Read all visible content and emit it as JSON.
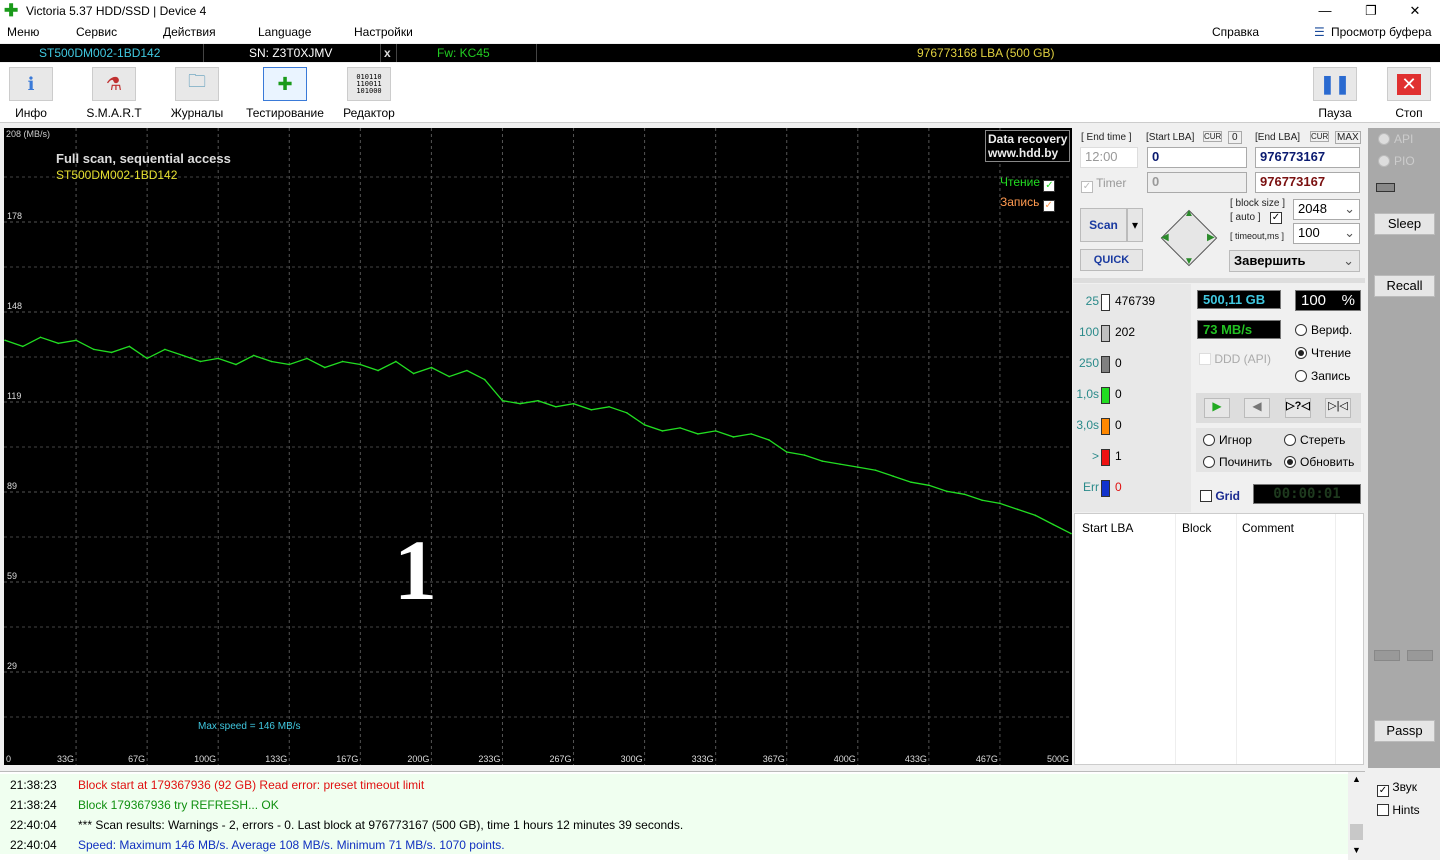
{
  "window": {
    "title": "Victoria 5.37 HDD/SSD | Device 4",
    "minimize": "—",
    "restore": "❐",
    "close": "✕"
  },
  "menu": {
    "items": [
      "Меню",
      "Сервис",
      "Действия",
      "Language",
      "Настройки"
    ],
    "help": "Справка",
    "buffer": "Просмотр буфера"
  },
  "device": {
    "model": "ST500DM002-1BD142",
    "serial": "SN: Z3T0XJMV",
    "x": "x",
    "firmware": "Fw: KC45",
    "capacity": "976773168 LBA (500 GB)"
  },
  "toolbar": {
    "items": [
      "Инфо",
      "S.M.A.R.T",
      "Журналы",
      "Тестирование",
      "Редактор"
    ],
    "pause": "Пауза",
    "stop": "Стоп"
  },
  "chart_data": {
    "type": "line",
    "title": "Full scan, sequential access",
    "subtitle": "ST500DM002-1BD142",
    "ylabel": "208 (MB/s)",
    "ylim": [
      0,
      208
    ],
    "xlim": [
      0,
      500
    ],
    "yticks": [
      178,
      148,
      119,
      89,
      59,
      29,
      0
    ],
    "xticks": [
      "0",
      "33G",
      "67G",
      "100G",
      "133G",
      "167G",
      "200G",
      "233G",
      "267G",
      "300G",
      "333G",
      "367G",
      "400G",
      "433G",
      "467G",
      "500G"
    ],
    "annotation": "Max speed = 146 MB/s",
    "grid": true,
    "legend": {
      "read": "Чтение",
      "write": "Запись",
      "placement": "top-right"
    },
    "big_label": "1",
    "watermark": [
      "Data recovery",
      "www.hdd.by"
    ],
    "series": [
      {
        "name": "Чтение",
        "color": "#22dd22",
        "values": [
          139,
          137,
          140,
          138,
          139,
          136,
          135,
          137,
          133,
          136,
          134,
          132,
          133,
          131,
          134,
          132,
          131,
          133,
          130,
          132,
          131,
          129,
          132,
          128,
          130,
          127,
          129,
          126,
          119,
          118,
          119,
          117,
          118,
          116,
          117,
          115,
          111,
          109,
          110,
          108,
          109,
          107,
          108,
          106,
          102,
          101,
          99,
          98,
          97,
          96,
          94,
          92,
          91,
          89,
          88,
          86,
          85,
          83,
          81,
          78,
          75
        ]
      }
    ]
  },
  "panel": {
    "end_time_label": "[ End time ]",
    "end_time": "12:00",
    "start_lba_label": "[Start LBA]",
    "cur": "CUR",
    "zero": "0",
    "end_lba_label": "[End LBA]",
    "max": "MAX",
    "start_lba": "0",
    "end_lba": "976773167",
    "timer_label": "Timer",
    "timer_value": "0",
    "end_lba2": "976773167",
    "scan": "Scan",
    "quick": "QUICK",
    "block_size_label": "[ block size ]",
    "auto_label": "[ auto ]",
    "timeout_label": "[ timeout,ms ]",
    "block_size": "2048",
    "timeout": "100",
    "finish": "Завершить",
    "legend": [
      {
        "n": "25",
        "v": "476739",
        "c": "#ffffff"
      },
      {
        "n": "100",
        "v": "202",
        "c": "#c0c0c0"
      },
      {
        "n": "250",
        "v": "0",
        "c": "#808080"
      },
      {
        "n": "1,0s",
        "v": "0",
        "c": "#22dd22"
      },
      {
        "n": "3,0s",
        "v": "0",
        "c": "#ff8800"
      },
      {
        "n": ">",
        "v": "1",
        "c": "#ee1111"
      },
      {
        "n": "Err",
        "v": "0",
        "c": "#1133cc"
      }
    ],
    "size": "500,11 GB",
    "percent": "100",
    "pct": "%",
    "speed": "73 MB/s",
    "ddd": "DDD (API)",
    "verify": "Вериф.",
    "read": "Чтение",
    "write": "Запись",
    "ignore": "Игнор",
    "erase": "Стереть",
    "repair": "Починить",
    "refresh": "Обновить",
    "grid": "Grid",
    "timer": "00:00:01",
    "table_headers": [
      "Start LBA",
      "Block",
      "Comment"
    ]
  },
  "side": {
    "api": "API",
    "pio": "PIO",
    "sleep": "Sleep",
    "recall": "Recall",
    "passp": "Passp",
    "sound": "Звук",
    "hints": "Hints"
  },
  "log": [
    {
      "time": "21:38:23",
      "msg": "Block start at 179367936 (92 GB) Read error: preset timeout limit",
      "color": "#e01010"
    },
    {
      "time": "21:38:24",
      "msg": "Block 179367936 try REFRESH... OK",
      "color": "#109010"
    },
    {
      "time": "22:40:04",
      "msg": "*** Scan results: Warnings - 2, errors - 0. Last block at 976773167 (500 GB), time 1 hours 12 minutes 39 seconds.",
      "color": "#000000"
    },
    {
      "time": "22:40:04",
      "msg": "Speed: Maximum 146 MB/s. Average 108 MB/s. Minimum 71 MB/s. 1070 points.",
      "color": "#1030c0"
    }
  ]
}
